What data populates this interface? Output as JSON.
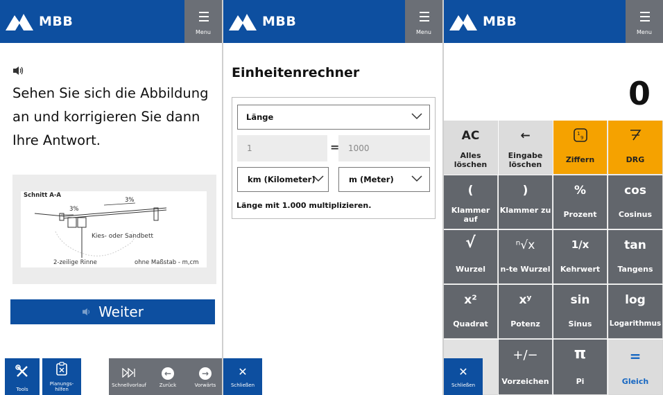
{
  "brand": "MBB",
  "menu_label": "Menu",
  "colors": {
    "header_blue": "#0d4fa0",
    "menu_gray": "#6b6f76",
    "accent_orange": "#f5a200",
    "equals_blue": "#1767c2"
  },
  "panel1": {
    "question": "Sehen Sie sich die Abbildung an und korrigieren Sie dann Ihre Antwort.",
    "figure": {
      "title": "Schnitt A-A",
      "slope_right": "3%",
      "slope_left": "3%",
      "bed_label": "Kies- oder Sandbett",
      "gutter_label": "2-zeilige Rinne",
      "scale_label": "ohne Maßstab - m,cm"
    },
    "next_button": "Weiter",
    "bottom": {
      "tools": "Tools",
      "planning": "Planungs-\nhilfen",
      "fast_forward": "Schnellvorlauf",
      "back": "Zurück",
      "forward": "Vorwärts"
    }
  },
  "panel2": {
    "title": "Einheitenrechner",
    "category": "Länge",
    "input_value": "1",
    "equals": "=",
    "output_value": "1000",
    "from_unit": "km (Kilometer)",
    "to_unit": "m (Meter)",
    "hint": "Länge mit 1.000 multiplizieren.",
    "close": "Schließen"
  },
  "panel3": {
    "display": "0",
    "close": "Schließen",
    "keys": [
      {
        "sym": "AC",
        "name": "Alles löschen"
      },
      {
        "sym": "←",
        "name": "Eingabe löschen"
      },
      {
        "sym": "",
        "name": "Ziffern"
      },
      {
        "sym": "",
        "name": "DRG"
      },
      {
        "sym": "(",
        "name": "Klammer auf"
      },
      {
        "sym": ")",
        "name": "Klammer zu"
      },
      {
        "sym": "%",
        "name": "Prozent"
      },
      {
        "sym": "cos",
        "name": "Cosinus"
      },
      {
        "sym": "√",
        "name": "Wurzel"
      },
      {
        "sym": "ⁿ√x",
        "name": "n-te Wurzel"
      },
      {
        "sym": "1/x",
        "name": "Kehrwert"
      },
      {
        "sym": "tan",
        "name": "Tangens"
      },
      {
        "sym": "x²",
        "name": "Quadrat"
      },
      {
        "sym": "xʸ",
        "name": "Potenz"
      },
      {
        "sym": "sin",
        "name": "Sinus"
      },
      {
        "sym": "log",
        "name": "Logarithmus"
      },
      {
        "sym": "+/−",
        "name": "Vorzeichen"
      },
      {
        "sym": "π",
        "name": "Pi"
      },
      {
        "sym": "=",
        "name": "Gleich"
      }
    ]
  }
}
